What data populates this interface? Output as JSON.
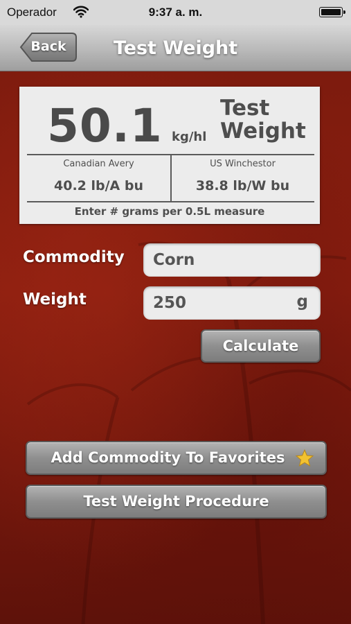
{
  "status_bar": {
    "carrier": "Operador",
    "time": "9:37 a. m.",
    "wifi_icon": "wifi-icon",
    "battery_icon": "battery-icon"
  },
  "nav": {
    "back_label": "Back",
    "title": "Test Weight"
  },
  "result": {
    "value": "50.1",
    "unit": "kg/hl",
    "title_line1": "Test",
    "title_line2": "Weight",
    "left_header": "Canadian Avery",
    "left_value": "40.2 lb/A bu",
    "right_header": "US Winchestor",
    "right_value": "38.8 lb/W bu",
    "footer": "Enter # grams per 0.5L measure"
  },
  "form": {
    "commodity_label": "Commodity",
    "commodity_value": "Corn",
    "weight_label": "Weight",
    "weight_value": "250",
    "weight_unit": "g",
    "calculate_label": "Calculate"
  },
  "actions": {
    "favorites_label": "Add Commodity To Favorites",
    "favorites_icon": "star-icon",
    "procedure_label": "Test Weight Procedure"
  },
  "colors": {
    "background": "#7a1a10",
    "nav_bar": "#b9b9b9",
    "card": "#ececec",
    "star": "#f2c230"
  }
}
